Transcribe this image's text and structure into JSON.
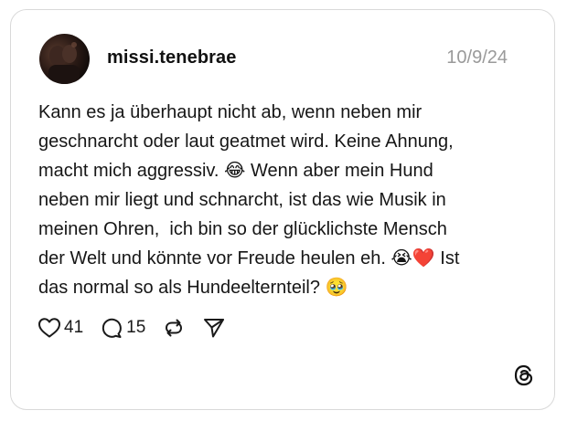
{
  "post": {
    "username": "missi.tenebrae",
    "date": "10/9/24",
    "text": "Kann es ja überhaupt nicht ab, wenn neben mir\ngeschnarcht oder laut geatmet wird. Keine Ahnung,\nmacht mich aggressiv. 😂 Wenn aber mein Hund\nneben mir liegt und schnarcht, ist das wie Musik in\nmeinen Ohren,  ich bin so der glücklichste Mensch\nder Welt und könnte vor Freude heulen eh. 😭❤️ Ist\ndas normal so als Hundeelternteil? 🥹",
    "likes": "41",
    "replies": "15"
  },
  "icons": {
    "avatar": "avatar",
    "like": "heart-icon",
    "reply": "comment-icon",
    "repost": "repost-icon",
    "share": "send-icon",
    "brand": "threads-logo-icon"
  },
  "colors": {
    "border": "#d9d9d9",
    "date": "#9a9a9a",
    "text": "#161616"
  }
}
